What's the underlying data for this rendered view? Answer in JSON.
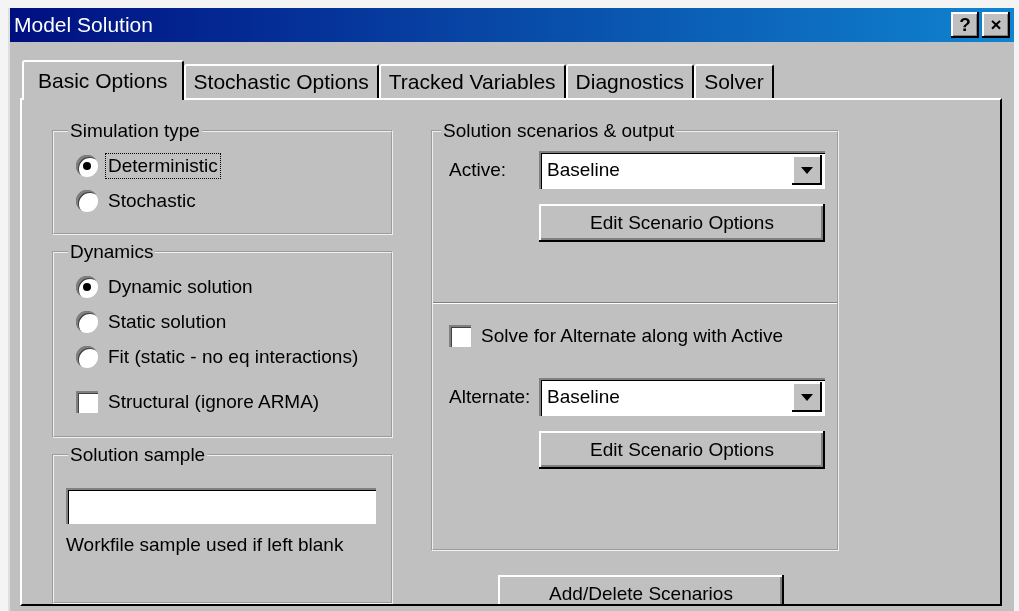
{
  "window": {
    "title": "Model Solution",
    "buttons": [
      "?",
      "×"
    ]
  },
  "tabs": [
    {
      "label": "Basic Options",
      "selected": true
    },
    {
      "label": "Stochastic Options",
      "selected": false
    },
    {
      "label": "Tracked Variables",
      "selected": false
    },
    {
      "label": "Diagnostics",
      "selected": false
    },
    {
      "label": "Solver",
      "selected": false
    }
  ],
  "simulation_type": {
    "title": "Simulation type",
    "options": [
      {
        "label": "Deterministic",
        "selected": true,
        "focused": true
      },
      {
        "label": "Stochastic",
        "selected": false,
        "focused": false
      }
    ]
  },
  "dynamics": {
    "title": "Dynamics",
    "options": [
      {
        "label": "Dynamic solution",
        "selected": true
      },
      {
        "label": "Static solution",
        "selected": false
      },
      {
        "label": "Fit (static - no eq interactions)",
        "selected": false
      }
    ],
    "checkbox": {
      "label": "Structural (ignore ARMA)",
      "checked": false
    }
  },
  "solution_sample": {
    "title": "Solution sample",
    "note": "Workfile sample used if left blank"
  },
  "scenarios": {
    "title": "Solution scenarios & output",
    "active": {
      "label": "Active:",
      "value": "Baseline",
      "button": "Edit Scenario Options"
    },
    "alternate_checkbox": {
      "label": "Solve for Alternate along with Active",
      "checked": false
    },
    "alternate": {
      "label": "Alternate:",
      "value": "Baseline",
      "button": "Edit Scenario Options"
    }
  },
  "add_delete_button": "Add/Delete Scenarios"
}
